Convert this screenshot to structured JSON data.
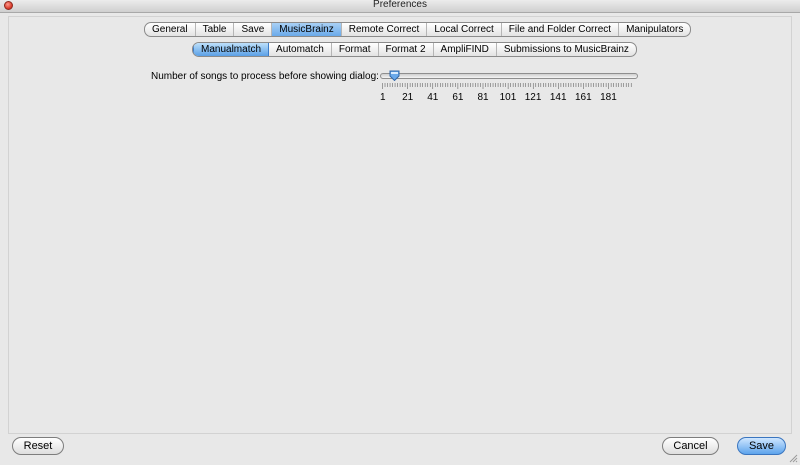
{
  "window": {
    "title": "Preferences"
  },
  "main_tabs": [
    {
      "label": "General",
      "selected": false
    },
    {
      "label": "Table",
      "selected": false
    },
    {
      "label": "Save",
      "selected": false
    },
    {
      "label": "MusicBrainz",
      "selected": true
    },
    {
      "label": "Remote Correct",
      "selected": false
    },
    {
      "label": "Local Correct",
      "selected": false
    },
    {
      "label": "File and Folder Correct",
      "selected": false
    },
    {
      "label": "Manipulators",
      "selected": false
    }
  ],
  "sub_tabs": [
    {
      "label": "Manualmatch",
      "selected": true
    },
    {
      "label": "Automatch",
      "selected": false
    },
    {
      "label": "Format",
      "selected": false
    },
    {
      "label": "Format 2",
      "selected": false
    },
    {
      "label": "AmpliFIND",
      "selected": false
    },
    {
      "label": "Submissions to MusicBrainz",
      "selected": false
    }
  ],
  "slider": {
    "label": "Number of songs to process before showing dialog:",
    "min": 1,
    "max": 200,
    "value": 10,
    "tick_labels": [
      "1",
      "21",
      "41",
      "61",
      "81",
      "101",
      "121",
      "141",
      "161",
      "181"
    ]
  },
  "buttons": {
    "reset": "Reset",
    "cancel": "Cancel",
    "save": "Save"
  },
  "colors": {
    "selection": "#6aa9ea",
    "primary_button": "#5da4ec"
  }
}
